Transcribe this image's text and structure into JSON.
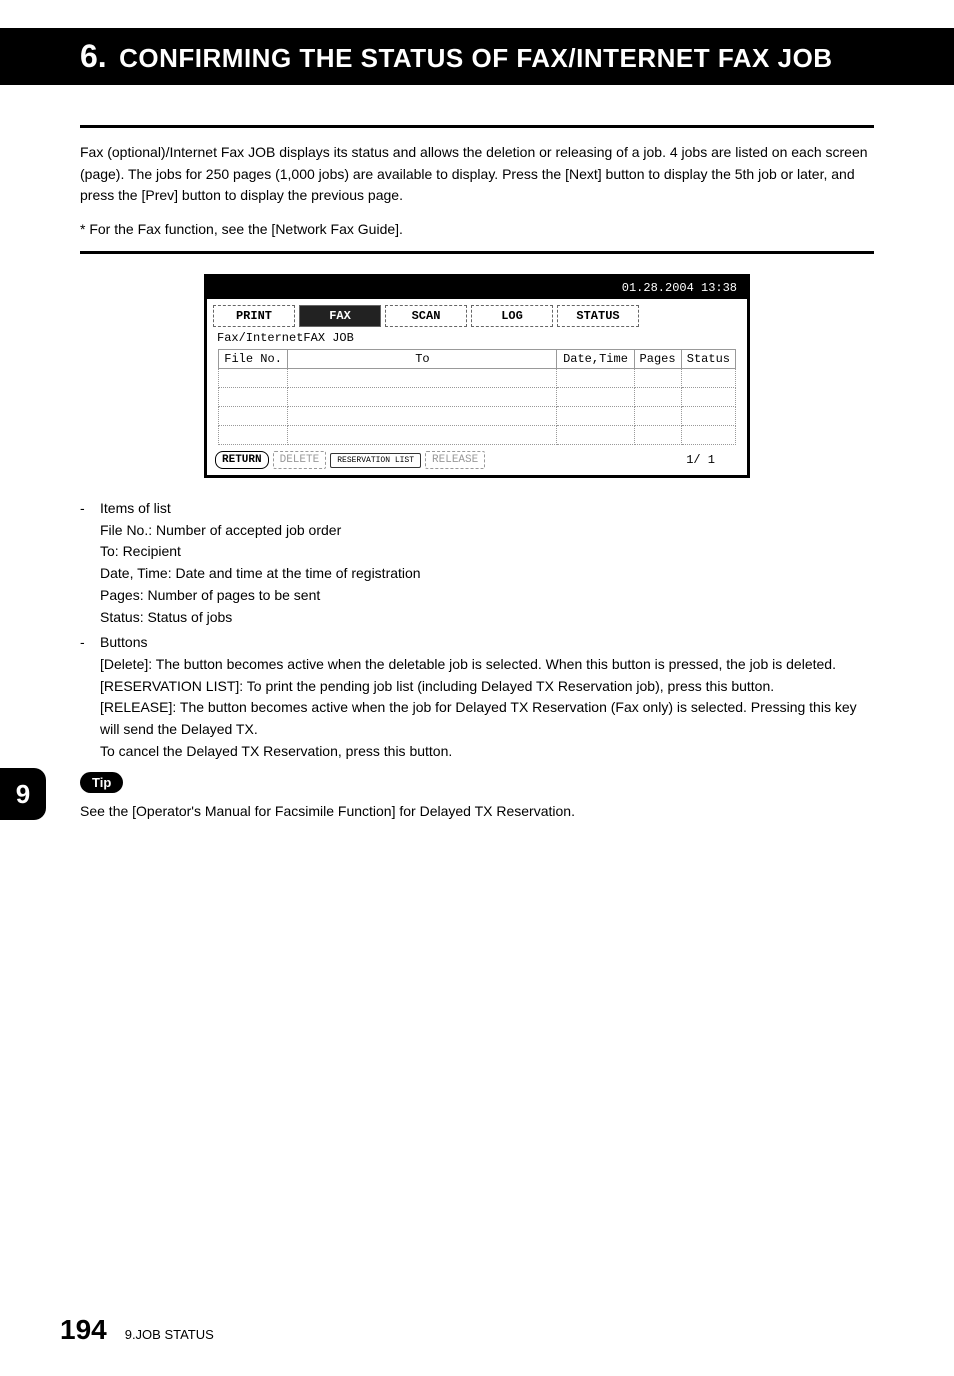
{
  "header": {
    "number": "6.",
    "title": "CONFIRMING THE STATUS OF FAX/INTERNET FAX JOB"
  },
  "intro": "Fax (optional)/Internet Fax JOB displays its status and allows the deletion or releasing of a job. 4 jobs are listed on each screen (page). The jobs for 250 pages (1,000 jobs) are available to display. Press the [Next] button to display the 5th job or later, and press the [Prev] button to display the previous page.",
  "note": "*  For the Fax function, see the [Network Fax Guide].",
  "device": {
    "datetime": "01.28.2004 13:38",
    "tabs": [
      "PRINT",
      "FAX",
      "SCAN",
      "LOG",
      "STATUS"
    ],
    "active_tab": "FAX",
    "subtitle": "Fax/InternetFAX JOB",
    "columns": [
      "File No.",
      "To",
      "Date,Time",
      "Pages",
      "Status"
    ],
    "buttons": {
      "return": "RETURN",
      "delete": "DELETE",
      "reservation": "RESERVATION LIST",
      "release": "RELEASE"
    },
    "pager": "1/  1"
  },
  "items_label": "Items of list",
  "items": [
    "File No.: Number of accepted job order",
    "To: Recipient",
    "Date, Time: Date and time at the time of registration",
    "Pages: Number of pages to be sent",
    "Status: Status of jobs"
  ],
  "buttons_label": "Buttons",
  "button_desc": [
    "[Delete]: The button becomes active when the deletable job is selected. When this button is pressed, the job is deleted.",
    "[RESERVATION LIST]: To print the pending job list (including Delayed TX Reservation job), press this button.",
    "[RELEASE]: The button becomes active when the job for Delayed TX Reservation (Fax only) is selected. Pressing this key will send the Delayed TX.",
    "To cancel the Delayed TX Reservation, press this button."
  ],
  "tip_label": "Tip",
  "tip_text": "See the [Operator's Manual for Facsimile Function] for Delayed TX Reservation.",
  "side_tab": "9",
  "footer": {
    "page": "194",
    "section": "9.JOB STATUS"
  }
}
